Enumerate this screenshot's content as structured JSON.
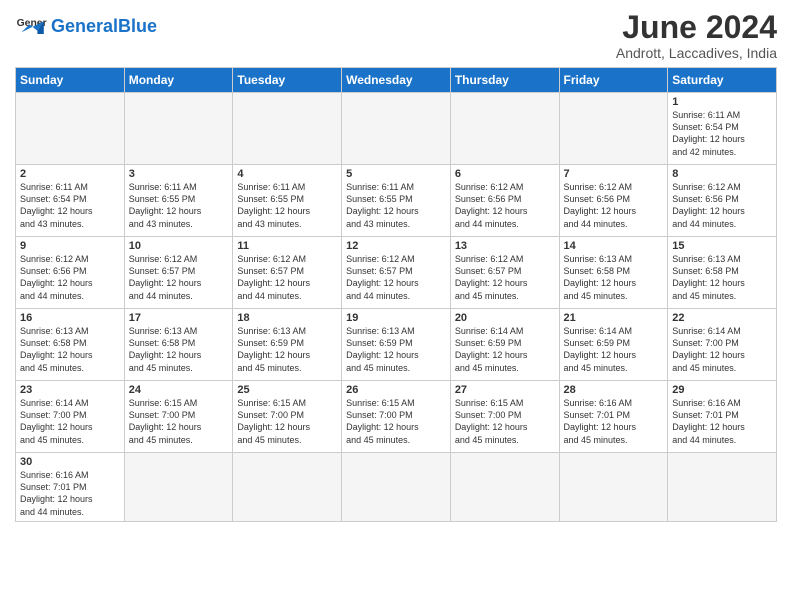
{
  "header": {
    "logo_general": "General",
    "logo_blue": "Blue",
    "month_title": "June 2024",
    "subtitle": "Andrott, Laccadives, India"
  },
  "days_of_week": [
    "Sunday",
    "Monday",
    "Tuesday",
    "Wednesday",
    "Thursday",
    "Friday",
    "Saturday"
  ],
  "weeks": [
    [
      {
        "day": "",
        "info": "",
        "empty": true
      },
      {
        "day": "",
        "info": "",
        "empty": true
      },
      {
        "day": "",
        "info": "",
        "empty": true
      },
      {
        "day": "",
        "info": "",
        "empty": true
      },
      {
        "day": "",
        "info": "",
        "empty": true
      },
      {
        "day": "",
        "info": "",
        "empty": true
      },
      {
        "day": "1",
        "info": "Sunrise: 6:11 AM\nSunset: 6:54 PM\nDaylight: 12 hours\nand 42 minutes."
      }
    ],
    [
      {
        "day": "2",
        "info": "Sunrise: 6:11 AM\nSunset: 6:54 PM\nDaylight: 12 hours\nand 43 minutes."
      },
      {
        "day": "3",
        "info": "Sunrise: 6:11 AM\nSunset: 6:55 PM\nDaylight: 12 hours\nand 43 minutes."
      },
      {
        "day": "4",
        "info": "Sunrise: 6:11 AM\nSunset: 6:55 PM\nDaylight: 12 hours\nand 43 minutes."
      },
      {
        "day": "5",
        "info": "Sunrise: 6:11 AM\nSunset: 6:55 PM\nDaylight: 12 hours\nand 43 minutes."
      },
      {
        "day": "6",
        "info": "Sunrise: 6:12 AM\nSunset: 6:56 PM\nDaylight: 12 hours\nand 44 minutes."
      },
      {
        "day": "7",
        "info": "Sunrise: 6:12 AM\nSunset: 6:56 PM\nDaylight: 12 hours\nand 44 minutes."
      },
      {
        "day": "8",
        "info": "Sunrise: 6:12 AM\nSunset: 6:56 PM\nDaylight: 12 hours\nand 44 minutes."
      }
    ],
    [
      {
        "day": "9",
        "info": "Sunrise: 6:12 AM\nSunset: 6:56 PM\nDaylight: 12 hours\nand 44 minutes."
      },
      {
        "day": "10",
        "info": "Sunrise: 6:12 AM\nSunset: 6:57 PM\nDaylight: 12 hours\nand 44 minutes."
      },
      {
        "day": "11",
        "info": "Sunrise: 6:12 AM\nSunset: 6:57 PM\nDaylight: 12 hours\nand 44 minutes."
      },
      {
        "day": "12",
        "info": "Sunrise: 6:12 AM\nSunset: 6:57 PM\nDaylight: 12 hours\nand 44 minutes."
      },
      {
        "day": "13",
        "info": "Sunrise: 6:12 AM\nSunset: 6:57 PM\nDaylight: 12 hours\nand 45 minutes."
      },
      {
        "day": "14",
        "info": "Sunrise: 6:13 AM\nSunset: 6:58 PM\nDaylight: 12 hours\nand 45 minutes."
      },
      {
        "day": "15",
        "info": "Sunrise: 6:13 AM\nSunset: 6:58 PM\nDaylight: 12 hours\nand 45 minutes."
      }
    ],
    [
      {
        "day": "16",
        "info": "Sunrise: 6:13 AM\nSunset: 6:58 PM\nDaylight: 12 hours\nand 45 minutes."
      },
      {
        "day": "17",
        "info": "Sunrise: 6:13 AM\nSunset: 6:58 PM\nDaylight: 12 hours\nand 45 minutes."
      },
      {
        "day": "18",
        "info": "Sunrise: 6:13 AM\nSunset: 6:59 PM\nDaylight: 12 hours\nand 45 minutes."
      },
      {
        "day": "19",
        "info": "Sunrise: 6:13 AM\nSunset: 6:59 PM\nDaylight: 12 hours\nand 45 minutes."
      },
      {
        "day": "20",
        "info": "Sunrise: 6:14 AM\nSunset: 6:59 PM\nDaylight: 12 hours\nand 45 minutes."
      },
      {
        "day": "21",
        "info": "Sunrise: 6:14 AM\nSunset: 6:59 PM\nDaylight: 12 hours\nand 45 minutes."
      },
      {
        "day": "22",
        "info": "Sunrise: 6:14 AM\nSunset: 7:00 PM\nDaylight: 12 hours\nand 45 minutes."
      }
    ],
    [
      {
        "day": "23",
        "info": "Sunrise: 6:14 AM\nSunset: 7:00 PM\nDaylight: 12 hours\nand 45 minutes."
      },
      {
        "day": "24",
        "info": "Sunrise: 6:15 AM\nSunset: 7:00 PM\nDaylight: 12 hours\nand 45 minutes."
      },
      {
        "day": "25",
        "info": "Sunrise: 6:15 AM\nSunset: 7:00 PM\nDaylight: 12 hours\nand 45 minutes."
      },
      {
        "day": "26",
        "info": "Sunrise: 6:15 AM\nSunset: 7:00 PM\nDaylight: 12 hours\nand 45 minutes."
      },
      {
        "day": "27",
        "info": "Sunrise: 6:15 AM\nSunset: 7:00 PM\nDaylight: 12 hours\nand 45 minutes."
      },
      {
        "day": "28",
        "info": "Sunrise: 6:16 AM\nSunset: 7:01 PM\nDaylight: 12 hours\nand 45 minutes."
      },
      {
        "day": "29",
        "info": "Sunrise: 6:16 AM\nSunset: 7:01 PM\nDaylight: 12 hours\nand 44 minutes."
      }
    ],
    [
      {
        "day": "30",
        "info": "Sunrise: 6:16 AM\nSunset: 7:01 PM\nDaylight: 12 hours\nand 44 minutes.",
        "last": true
      },
      {
        "day": "",
        "info": "",
        "empty": true,
        "last": true
      },
      {
        "day": "",
        "info": "",
        "empty": true,
        "last": true
      },
      {
        "day": "",
        "info": "",
        "empty": true,
        "last": true
      },
      {
        "day": "",
        "info": "",
        "empty": true,
        "last": true
      },
      {
        "day": "",
        "info": "",
        "empty": true,
        "last": true
      },
      {
        "day": "",
        "info": "",
        "empty": true,
        "last": true
      }
    ]
  ]
}
